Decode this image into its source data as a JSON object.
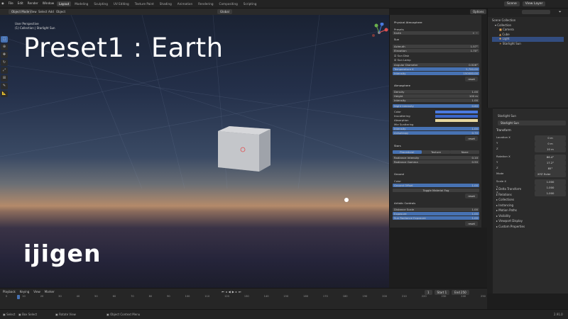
{
  "menu": [
    "File",
    "Edit",
    "Render",
    "Window",
    "Help"
  ],
  "workspaces": [
    "Layout",
    "Modeling",
    "Sculpting",
    "UV Editing",
    "Texture Paint",
    "Shading",
    "Animation",
    "Rendering",
    "Compositing",
    "Scripting"
  ],
  "active_workspace": "Layout",
  "scene": "Scene",
  "view_layer": "View Layer",
  "viewport": {
    "mode": "Object Mode",
    "menus": [
      "View",
      "Select",
      "Add",
      "Object"
    ],
    "transform": "Global",
    "options": "Options",
    "info_line1": "User Perspective",
    "info_line2": "(1) Collection | Starlight Sun",
    "overlay_title": "Preset1 : Earth",
    "logo_text": "ijigen"
  },
  "atmos_panel": {
    "title": "Physical Atmosphere",
    "presets_label": "Presets",
    "preset_value": "Earth",
    "sun_header": "Sun",
    "sun_rows": [
      {
        "label": "Azimuth",
        "value": "1.57°"
      },
      {
        "label": "Elevation",
        "value": "1.70°"
      },
      {
        "label": "Sun Disk",
        "value": ""
      },
      {
        "label": "Sun Lamp",
        "value": ""
      },
      {
        "label": "Angular Diameter",
        "value": "0.526°"
      },
      {
        "label": "Temperature K",
        "value": "5,700.00"
      },
      {
        "label": "Intensity",
        "value": "150000.00"
      }
    ],
    "atmos_header": "Atmosphere",
    "atmos_rows": [
      {
        "label": "Density",
        "value": "1.00"
      },
      {
        "label": "Height",
        "value": "100 m"
      },
      {
        "label": "Intensity",
        "value": "1.00"
      },
      {
        "label": "Night Intensity",
        "value": "0.60"
      }
    ],
    "color_rows": [
      "Color",
      "Inscattering",
      "Absorption",
      "Mie Scattering"
    ],
    "mie_rows": [
      {
        "label": "Intensity",
        "value": "1.00"
      },
      {
        "label": "Anisotropy",
        "value": "0.70"
      }
    ],
    "stars_header": "Stars",
    "stars_tabs": [
      "Procedural",
      "Texture",
      "None"
    ],
    "stars_rows": [
      {
        "label": "Radiance Intensity",
        "value": "0.10"
      },
      {
        "label": "Radiance Gamma",
        "value": "0.50"
      }
    ],
    "ground_header": "Ground",
    "ground_rows": [
      {
        "label": "Color",
        "value": ""
      },
      {
        "label": "Ground Offset",
        "value": "1.00"
      }
    ],
    "ground_button": "Toggle Material Fog",
    "artistic_header": "Artistic Controls",
    "artistic_rows": [
      {
        "label": "Distance Scale",
        "value": "1.00"
      },
      {
        "label": "Exposure",
        "value": "1.00"
      },
      {
        "label": "Sun Radiance Exposure",
        "value": "1.00"
      }
    ],
    "reset_label": "reset"
  },
  "outliner": {
    "root": "Scene Collection",
    "items": [
      "Collection",
      "Camera",
      "Cube",
      "Light",
      "Starlight Sun"
    ]
  },
  "properties": {
    "object_name": "Starlight Sun",
    "data_name": "Starlight Sun",
    "transform_header": "Transform",
    "location": [
      "0 m",
      "0 m",
      "10 m"
    ],
    "rotation": [
      "86.4°",
      "17.2°",
      "85°"
    ],
    "mode_label": "Mode",
    "mode_value": "XYZ Euler",
    "scale": [
      "1.000",
      "1.000",
      "1.000"
    ],
    "sections": [
      "Delta Transform",
      "Relations",
      "Collections",
      "Instancing",
      "Motion Paths",
      "Visibility",
      "Viewport Display",
      "Custom Properties"
    ]
  },
  "timeline": {
    "menus": [
      "Playback",
      "Keying",
      "View",
      "Marker"
    ],
    "current_frame": "1",
    "start_label": "Start",
    "start": "1",
    "end_label": "End",
    "end": "250",
    "ticks": [
      "0",
      "10",
      "20",
      "30",
      "40",
      "50",
      "60",
      "70",
      "80",
      "90",
      "100",
      "110",
      "120",
      "130",
      "140",
      "150",
      "160",
      "170",
      "180",
      "190",
      "200",
      "210",
      "220",
      "230",
      "240",
      "250"
    ]
  },
  "status": {
    "select": "Select",
    "box_select": "Box Select",
    "rotate": "Rotate View",
    "context": "Object Context Menu",
    "version": "2.91.0"
  },
  "colors": {
    "accent": "#4772b3",
    "sky_top": "#1a2233",
    "horizon": "#b48a6a"
  }
}
